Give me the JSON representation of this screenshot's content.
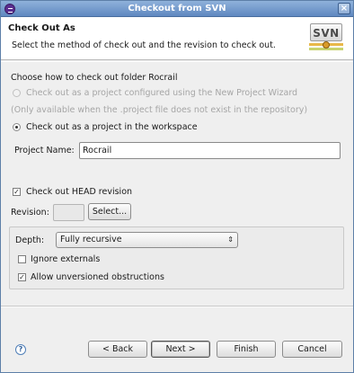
{
  "window": {
    "title": "Checkout from SVN"
  },
  "header": {
    "title": "Check Out As",
    "subtitle": "Select the method of check out and the revision to check out.",
    "logo_text": "SVN"
  },
  "checkout": {
    "prompt": "Choose how to check out folder Rocrail",
    "option_wizard": "Check out as a project configured using the New Project Wizard",
    "option_wizard_note": "(Only available when the .project file does not exist in the repository)",
    "option_workspace": "Check out as a project in the workspace",
    "project_name_label": "Project Name:",
    "project_name_value": "Rocrail"
  },
  "revision": {
    "head_label": "Check out HEAD revision",
    "head_checked": true,
    "revision_label": "Revision:",
    "select_button": "Select..."
  },
  "options": {
    "depth_label": "Depth:",
    "depth_value": "Fully recursive",
    "ignore_externals_label": "Ignore externals",
    "ignore_externals_checked": false,
    "allow_unversioned_label": "Allow unversioned obstructions",
    "allow_unversioned_checked": true
  },
  "footer": {
    "help": "?",
    "back_button": "< Back",
    "next_button": "Next >",
    "finish_button": "Finish",
    "cancel_button": "Cancel"
  }
}
